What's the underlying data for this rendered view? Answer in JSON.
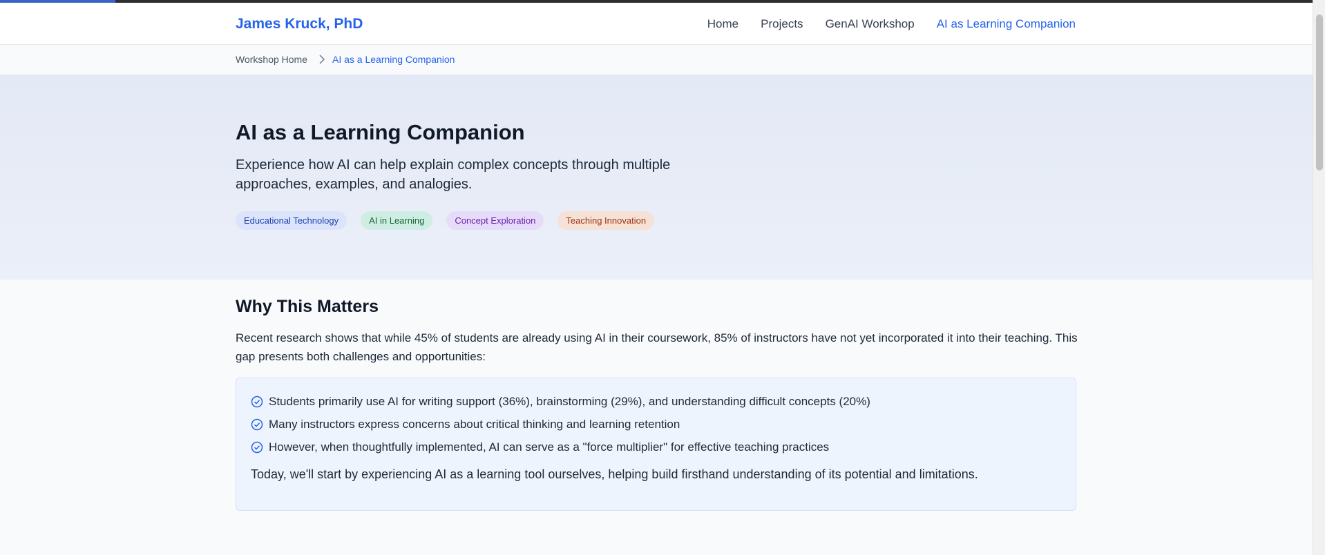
{
  "page": {
    "scroll_progress": 0.088
  },
  "header": {
    "brand": "James Kruck, PhD",
    "nav": [
      {
        "label": "Home"
      },
      {
        "label": "Projects"
      },
      {
        "label": "GenAI Workshop"
      },
      {
        "label": "AI as Learning Companion",
        "active": true
      }
    ]
  },
  "breadcrumb": {
    "home": "Workshop Home",
    "current": "AI as a Learning Companion"
  },
  "hero": {
    "title": "AI as a Learning Companion",
    "subtitle": "Experience how AI can help explain complex concepts through multiple approaches, examples, and analogies.",
    "tags": [
      {
        "label": "Educational Technology",
        "color": "blue"
      },
      {
        "label": "AI in Learning",
        "color": "green"
      },
      {
        "label": "Concept Exploration",
        "color": "purple"
      },
      {
        "label": "Teaching Innovation",
        "color": "orange"
      }
    ]
  },
  "why": {
    "title": "Why This Matters",
    "intro": "Recent research shows that while 45% of students are already using AI in their coursework, 85% of instructors have not yet incorporated it into their teaching. This gap presents both challenges and opportunities:",
    "points": [
      "Students primarily use AI for writing support (36%), brainstorming (29%), and understanding difficult concepts (20%)",
      "Many instructors express concerns about critical thinking and learning retention",
      "However, when thoughtfully implemented, AI can serve as a \"force multiplier\" for effective teaching practices"
    ],
    "footer": "Today, we'll start by experiencing AI as a learning tool ourselves, helping build firsthand understanding of its potential and limitations."
  },
  "colors": {
    "accent": "#2563eb",
    "hero_bg": "#e3e9f6",
    "callout_bg": "#eef4fd"
  }
}
